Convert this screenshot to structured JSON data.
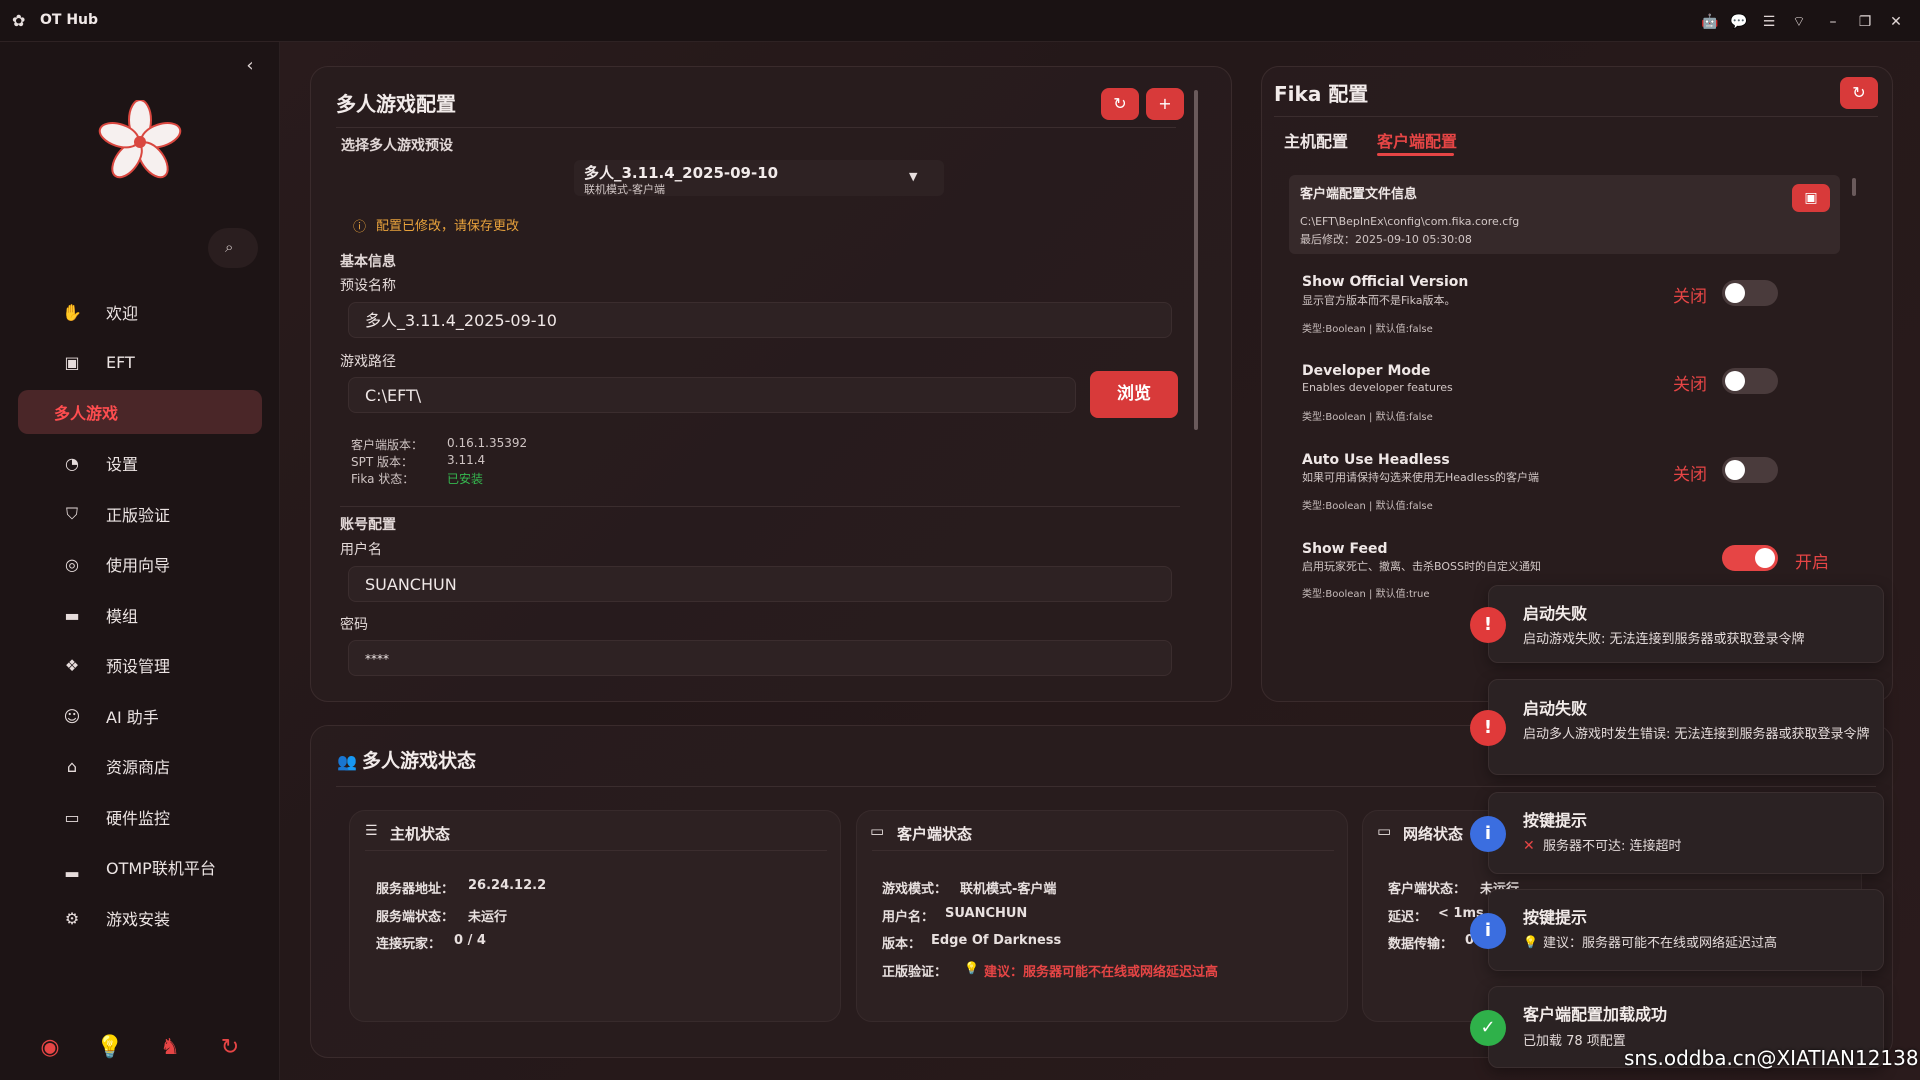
{
  "app": {
    "title": "OT Hub"
  },
  "sidebar": {
    "items": [
      {
        "label": "欢迎",
        "icon": "hand-icon"
      },
      {
        "label": "EFT",
        "icon": "eft-icon"
      },
      {
        "label": "多人游戏",
        "icon": ""
      },
      {
        "label": "设置",
        "icon": "palette-icon"
      },
      {
        "label": "正版验证",
        "icon": "shield-icon"
      },
      {
        "label": "使用向导",
        "icon": "compass-icon"
      },
      {
        "label": "模组",
        "icon": "mod-icon"
      },
      {
        "label": "预设管理",
        "icon": "cards-icon"
      },
      {
        "label": "AI 助手",
        "icon": "robot-icon"
      },
      {
        "label": "资源商店",
        "icon": "store-icon"
      },
      {
        "label": "硬件监控",
        "icon": "monitor-icon"
      },
      {
        "label": "OTMP联机平台",
        "icon": "laptop-icon"
      },
      {
        "label": "游戏安装",
        "icon": "gear-icon"
      }
    ]
  },
  "multiplayer_config": {
    "title": "多人游戏配置",
    "preset_label": "选择多人游戏预设",
    "preset_value": "多人_3.11.4_2025-09-10",
    "preset_sub": "联机模式-客户端",
    "warning": "配置已修改，请保存更改",
    "basic_info": "基本信息",
    "preset_name_label": "预设名称",
    "preset_name_value": "多人_3.11.4_2025-09-10",
    "game_path_label": "游戏路径",
    "game_path_value": "C:\\EFT\\",
    "browse": "浏览",
    "client_version_label": "客户端版本：",
    "client_version": "0.16.1.35392",
    "spt_version_label": "SPT 版本：",
    "spt_version": "3.11.4",
    "fika_status_label": "Fika 状态：",
    "fika_status": "已安装",
    "account_config": "账号配置",
    "username_label": "用户名",
    "username_value": "SUANCHUN",
    "password_label": "密码",
    "password_value": "****"
  },
  "fika_config": {
    "title": "Fika 配置",
    "tab_host": "主机配置",
    "tab_client": "客户端配置",
    "file_info_title": "客户端配置文件信息",
    "file_path": "C:\\EFT\\BepInEx\\config\\com.fika.core.cfg",
    "last_modified": "最后修改：2025-09-10 05:30:08",
    "settings": [
      {
        "title": "Show Official Version",
        "desc": "显示官方版本而不是Fika版本。",
        "meta": "类型:Boolean | 默认值:false",
        "state": "关闭",
        "on": false
      },
      {
        "title": "Developer Mode",
        "desc": "Enables developer features",
        "meta": "类型:Boolean | 默认值:false",
        "state": "关闭",
        "on": false
      },
      {
        "title": "Auto Use Headless",
        "desc": "如果可用请保持勾选来使用无Headless的客户端",
        "meta": "类型:Boolean | 默认值:false",
        "state": "关闭",
        "on": false
      },
      {
        "title": "Show Feed",
        "desc": "启用玩家死亡、撤离、击杀BOSS时的自定义通知",
        "meta": "类型:Boolean | 默认值:true",
        "state": "开启",
        "on": true
      }
    ]
  },
  "status": {
    "title": "多人游戏状态",
    "host": {
      "title": "主机状态",
      "rows": [
        {
          "k": "服务器地址：",
          "v": "26.24.12.2"
        },
        {
          "k": "服务端状态：",
          "v": "未运行"
        },
        {
          "k": "连接玩家：",
          "v": "0 / 4"
        }
      ]
    },
    "client": {
      "title": "客户端状态",
      "rows": [
        {
          "k": "游戏模式：",
          "v": "联机模式-客户端"
        },
        {
          "k": "用户名：",
          "v": "SUANCHUN"
        },
        {
          "k": "版本：",
          "v": "Edge Of Darkness"
        }
      ],
      "auth_label": "正版验证：",
      "auth_value": "建议：服务器可能不在线或网络延迟过高"
    },
    "network": {
      "title": "网络状态",
      "rows": [
        {
          "k": "客户端状态：",
          "v": "未运行"
        },
        {
          "k": "延迟：",
          "v": "< 1ms"
        },
        {
          "k": "数据传输：",
          "v": "0"
        }
      ]
    }
  },
  "toasts": [
    {
      "title": "启动失败",
      "msg": "启动游戏失败: 无法连接到服务器或获取登录令牌",
      "type": "error"
    },
    {
      "title": "启动失败",
      "msg": "启动多人游戏时发生错误: 无法连接到服务器或获取登录令牌",
      "type": "error"
    },
    {
      "title": "按键提示",
      "msg": "服务器不可达: 连接超时",
      "type": "info"
    },
    {
      "title": "按键提示",
      "msg": "建议：服务器可能不在线或网络延迟过高",
      "type": "info"
    },
    {
      "title": "客户端配置加载成功",
      "msg": "已加载 78 项配置",
      "type": "success"
    }
  ],
  "watermark": "sns.oddba.cn@XIATIAN12138",
  "colors": {
    "accent": "#e64545",
    "success": "#2fb14a",
    "info": "#3b6ee0"
  }
}
